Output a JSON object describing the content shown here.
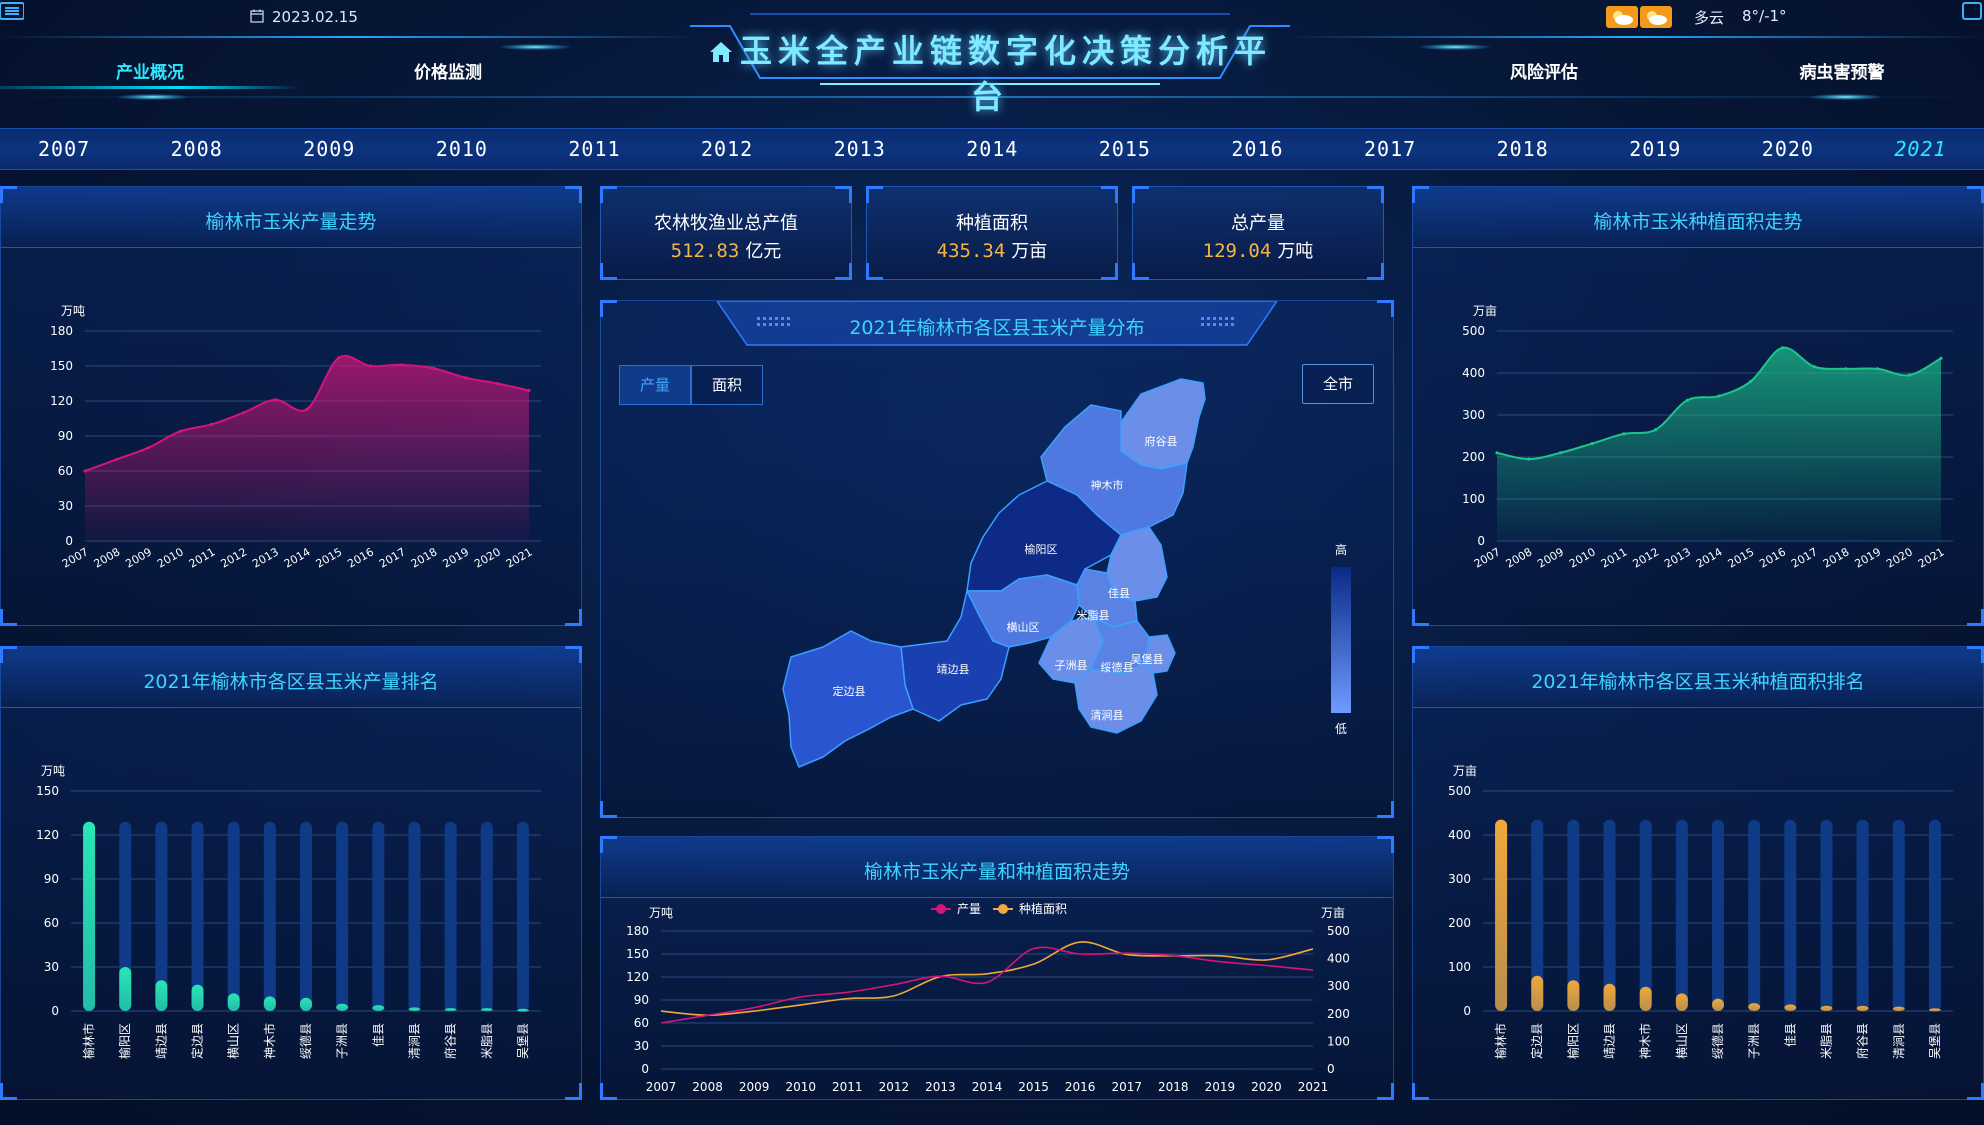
{
  "header": {
    "date": "2023.02.15",
    "title": "玉米全产业链数字化决策分析平台",
    "nav": [
      "产业概况",
      "价格监测",
      "风险评估",
      "病虫害预警"
    ],
    "active_nav": 0,
    "weather_desc": "多云",
    "weather_temp": "8°/-1°"
  },
  "years": [
    "2007",
    "2008",
    "2009",
    "2010",
    "2011",
    "2012",
    "2013",
    "2014",
    "2015",
    "2016",
    "2017",
    "2018",
    "2019",
    "2020",
    "2021"
  ],
  "active_year": "2021",
  "stats": [
    {
      "label": "农林牧渔业总产值",
      "value": "512.83",
      "unit": "亿元"
    },
    {
      "label": "种植面积",
      "value": "435.34",
      "unit": "万亩"
    },
    {
      "label": "总产量",
      "value": "129.04",
      "unit": "万吨"
    }
  ],
  "map": {
    "title": "2021年榆林市各区县玉米产量分布",
    "tabs": [
      "产量",
      "面积"
    ],
    "active_tab": 0,
    "all_button": "全市",
    "legend_high": "高",
    "legend_low": "低",
    "regions": [
      "府谷县",
      "神木市",
      "榆阳区",
      "佳县",
      "米脂县",
      "横山区",
      "靖边县",
      "子洲县",
      "绥德县",
      "吴堡县",
      "定边县",
      "清涧县"
    ]
  },
  "colors": {
    "magenta": "#d6147a",
    "green": "#1cc68a",
    "cyan_bar": "#29e6b4",
    "gold_bar": "#f0a93a",
    "bg_bar": "#0f3b86",
    "accent": "#2ee7ff"
  },
  "chart_data": [
    {
      "id": "production-trend",
      "type": "area",
      "title": "榆林市玉米产量走势",
      "ylabel": "万吨",
      "x": [
        "2007",
        "2008",
        "2009",
        "2010",
        "2011",
        "2012",
        "2013",
        "2014",
        "2015",
        "2016",
        "2017",
        "2018",
        "2019",
        "2020",
        "2021"
      ],
      "values": [
        60,
        70,
        80,
        94,
        100,
        110,
        121,
        113,
        157,
        150,
        151,
        148,
        140,
        135,
        129
      ],
      "ylim": [
        0,
        180
      ],
      "yticks": [
        0,
        30,
        60,
        90,
        120,
        150,
        180
      ]
    },
    {
      "id": "area-trend",
      "type": "area",
      "title": "榆林市玉米种植面积走势",
      "ylabel": "万亩",
      "x": [
        "2007",
        "2008",
        "2009",
        "2010",
        "2011",
        "2012",
        "2013",
        "2014",
        "2015",
        "2016",
        "2017",
        "2018",
        "2019",
        "2020",
        "2021"
      ],
      "values": [
        210,
        195,
        210,
        232,
        255,
        265,
        335,
        345,
        380,
        460,
        415,
        410,
        410,
        395,
        435
      ],
      "ylim": [
        0,
        500
      ],
      "yticks": [
        0,
        100,
        200,
        300,
        400,
        500
      ]
    },
    {
      "id": "production-ranking",
      "type": "bar",
      "title": "2021年榆林市各区县玉米产量排名",
      "ylabel": "万吨",
      "categories": [
        "榆林市",
        "榆阳区",
        "靖边县",
        "定边县",
        "横山区",
        "神木市",
        "绥德县",
        "子洲县",
        "佳县",
        "清涧县",
        "府谷县",
        "米脂县",
        "吴堡县"
      ],
      "values": [
        129,
        30,
        21,
        18,
        12,
        10,
        9,
        5,
        4,
        2.5,
        2,
        2,
        1.5
      ],
      "ylim": [
        0,
        150
      ],
      "yticks": [
        0,
        30,
        60,
        90,
        120,
        150
      ]
    },
    {
      "id": "area-ranking",
      "type": "bar",
      "title": "2021年榆林市各区县玉米种植面积排名",
      "ylabel": "万亩",
      "categories": [
        "榆林市",
        "定边县",
        "榆阳区",
        "靖边县",
        "神木市",
        "横山区",
        "绥德县",
        "子洲县",
        "佳县",
        "米脂县",
        "府谷县",
        "清涧县",
        "吴堡县"
      ],
      "values": [
        435,
        80,
        70,
        62,
        55,
        40,
        28,
        18,
        15,
        12,
        12,
        10,
        6
      ],
      "ylim": [
        0,
        500
      ],
      "yticks": [
        0,
        100,
        200,
        300,
        400,
        500
      ]
    },
    {
      "id": "production-area-trend",
      "type": "line",
      "title": "榆林市玉米产量和种植面积走势",
      "x": [
        "2007",
        "2008",
        "2009",
        "2010",
        "2011",
        "2012",
        "2013",
        "2014",
        "2015",
        "2016",
        "2017",
        "2018",
        "2019",
        "2020",
        "2021"
      ],
      "series": [
        {
          "name": "产量",
          "axis": "left",
          "values": [
            60,
            70,
            80,
            94,
            100,
            110,
            121,
            113,
            157,
            150,
            151,
            148,
            140,
            135,
            129
          ]
        },
        {
          "name": "种植面积",
          "axis": "right",
          "values": [
            210,
            195,
            210,
            232,
            255,
            265,
            335,
            345,
            380,
            460,
            415,
            410,
            410,
            395,
            435
          ]
        }
      ],
      "left_label": "万吨",
      "right_label": "万亩",
      "left_ticks": [
        0,
        30,
        60,
        90,
        120,
        150,
        180
      ],
      "right_ticks": [
        0,
        100,
        200,
        300,
        400,
        500
      ]
    }
  ]
}
